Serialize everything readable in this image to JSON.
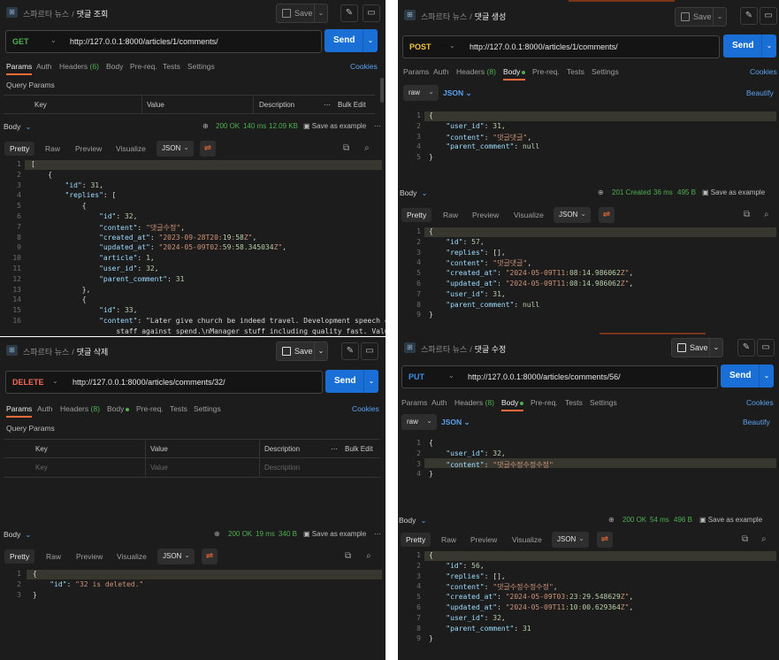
{
  "app": {
    "workspace": "스파르타 뉴스",
    "save_label": "Save",
    "send_label": "Send",
    "cookies_label": "Cookies",
    "beautify_label": "Beautify",
    "body_label": "Body",
    "json_label": "JSON",
    "raw_label": "raw",
    "save_example_label": "Save as example",
    "query_params_label": "Query Params",
    "bulk_edit_label": "Bulk Edit"
  },
  "request_tabs": [
    "Params",
    "Auth",
    "Headers",
    "Body",
    "Pre-req.",
    "Tests",
    "Settings"
  ],
  "response_tabs": [
    "Pretty",
    "Raw",
    "Preview",
    "Visualize"
  ],
  "table_headers": {
    "key": "Key",
    "value": "Value",
    "description": "Description"
  },
  "panels": [
    {
      "id": "get",
      "name": "댓글 조회",
      "method": "GET",
      "method_color": "#4cb050",
      "url": "http://127.0.0.1:8000/articles/1/comments/",
      "active_tab": "Params",
      "headers_count": "(6)",
      "status": {
        "code": "200 OK",
        "time": "140 ms",
        "size": "12.09 KB"
      },
      "response_lines": [
        "[",
        "    {",
        "        \"id\": 31,",
        "        \"replies\": [",
        "            {",
        "                \"id\": 32,",
        "                \"content\": \"댓글수정\",",
        "                \"created_at\": \"2023-09-28T20:19:58Z\",",
        "                \"updated_at\": \"2024-05-09T02:59:58.345034Z\",",
        "                \"article\": 1,",
        "                \"user_id\": 32,",
        "                \"parent_comment\": 31",
        "            },",
        "            {",
        "                \"id\": 33,",
        "                \"content\": \"Later give church be indeed travel. Development speech call",
        "                    staff against spend.\\nManager stuff including quality fast. Value"
      ],
      "response_line_numbers": [
        "1",
        "2",
        "3",
        "4",
        "5",
        "6",
        "7",
        "8",
        "9",
        "10",
        "11",
        "12",
        "13",
        "14",
        "15",
        "16",
        ""
      ]
    },
    {
      "id": "post",
      "name": "댓글 생성",
      "method": "POST",
      "method_color": "#f5c242",
      "url": "http://127.0.0.1:8000/articles/1/comments/",
      "active_tab": "Body",
      "headers_count": "(8)",
      "body_lines": [
        "{",
        "    \"user_id\": 31,",
        "    \"content\": \"댓글댓글\",",
        "    \"parent_comment\": null",
        "}"
      ],
      "status": {
        "code": "201 Created",
        "time": "36 ms",
        "size": "495 B"
      },
      "response_lines": [
        "{",
        "    \"id\": 57,",
        "    \"replies\": [],",
        "    \"content\": \"댓글댓글\",",
        "    \"created_at\": \"2024-05-09T11:08:14.986062Z\",",
        "    \"updated_at\": \"2024-05-09T11:08:14.986062Z\",",
        "    \"user_id\": 31,",
        "    \"parent_comment\": null",
        "}"
      ]
    },
    {
      "id": "delete",
      "name": "댓글 삭제",
      "method": "DELETE",
      "method_color": "#f06a5a",
      "url": "http://127.0.0.1:8000/articles/comments/32/",
      "active_tab": "Params",
      "headers_count": "(8)",
      "key_placeholder": "Key",
      "value_placeholder": "Value",
      "description_placeholder": "Description",
      "status": {
        "code": "200 OK",
        "time": "19 ms",
        "size": "340 B"
      },
      "response_lines": [
        "{",
        "    \"id\": \"32 is deleted.\"",
        "}"
      ]
    },
    {
      "id": "put",
      "name": "댓글 수정",
      "method": "PUT",
      "method_color": "#3b8fe8",
      "url": "http://127.0.0.1:8000/articles/comments/56/",
      "active_tab": "Body",
      "headers_count": "(8)",
      "body_lines": [
        "{",
        "    \"user_id\": 32,",
        "    \"content\": \"댓글수정수정수정\"",
        "}"
      ],
      "status": {
        "code": "200 OK",
        "time": "54 ms",
        "size": "496 B"
      },
      "response_lines": [
        "{",
        "    \"id\": 56,",
        "    \"replies\": [],",
        "    \"content\": \"댓글수정수정수정\",",
        "    \"created_at\": \"2024-05-09T03:23:29.548629Z\",",
        "    \"updated_at\": \"2024-05-09T11:10:00.629364Z\",",
        "    \"user_id\": 32,",
        "    \"parent_comment\": 31",
        "}"
      ]
    }
  ]
}
